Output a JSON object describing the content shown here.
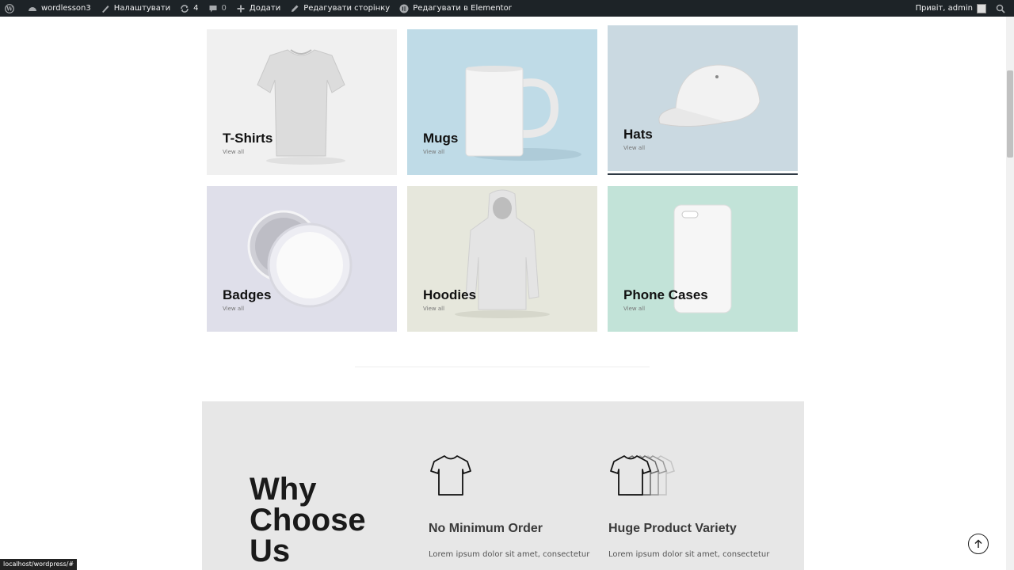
{
  "adminbar": {
    "site_name": "wordlesson3",
    "customize": "Налаштувати",
    "updates_count": "4",
    "comments_count": "0",
    "add_new": "Додати",
    "edit_page": "Редагувати сторінку",
    "edit_elementor": "Редагувати в Elementor",
    "greeting": "Привіт, admin"
  },
  "categories": [
    {
      "title": "T-Shirts",
      "link": "View all",
      "bg": "#f0f0f0"
    },
    {
      "title": "Mugs",
      "link": "View all",
      "bg": "#bfdbe7"
    },
    {
      "title": "Hats",
      "link": "View all",
      "bg": "#cad9e1"
    },
    {
      "title": "Badges",
      "link": "View all",
      "bg": "#dfdfea"
    },
    {
      "title": "Hoodies",
      "link": "View all",
      "bg": "#e6e7dc"
    },
    {
      "title": "Phone Cases",
      "link": "View all",
      "bg": "#c2e3d8"
    }
  ],
  "why": {
    "title_line1": "Why",
    "title_line2": "Choose",
    "title_line3": "Us",
    "features": [
      {
        "name": "No Minimum Order",
        "desc": "Lorem ipsum dolor sit amet, consectetur"
      },
      {
        "name": "Huge Product Variety",
        "desc": "Lorem ipsum dolor sit amet, consectetur"
      }
    ]
  },
  "status_url": "localhost/wordpress/#"
}
